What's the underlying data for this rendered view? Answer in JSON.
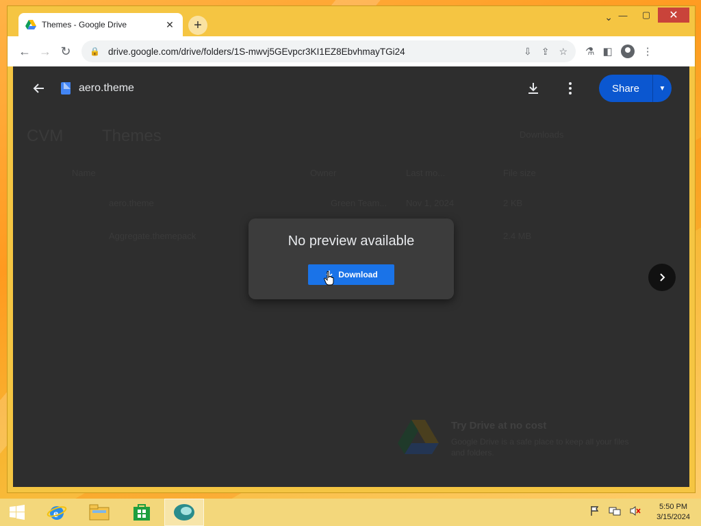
{
  "browser": {
    "tab_title": "Themes - Google Drive",
    "url": "drive.google.com/drive/folders/1S-mwvj5GEvpcr3KI1EZ8EbvhmayTGi24"
  },
  "background_drive": {
    "breadcrumb_parent": "CVM",
    "breadcrumb_current": "Themes",
    "downloads_label": "Downloads",
    "columns": {
      "name": "Name",
      "owner": "Owner",
      "last_modified": "Last mo...",
      "file_size": "File size"
    },
    "rows": [
      {
        "name": "aero.theme",
        "owner": "Green Team...",
        "modified": "Nov 1, 2024",
        "size": "2 KB"
      },
      {
        "name": "Aggregate.themepack",
        "owner": "",
        "modified": "",
        "size": "2.4 MB"
      }
    ],
    "promo_title": "Try Drive at no cost",
    "promo_text": "Google Drive is a safe place to keep all your files and folders."
  },
  "preview": {
    "file_name": "aero.theme",
    "share_label": "Share",
    "modal_title": "No preview available",
    "download_button": "Download"
  },
  "taskbar": {
    "time": "5:50 PM",
    "date": "3/15/2024"
  },
  "colors": {
    "accent_blue": "#1a73e8",
    "share_blue": "#0b57d0",
    "window_frame": "#f5c542"
  }
}
